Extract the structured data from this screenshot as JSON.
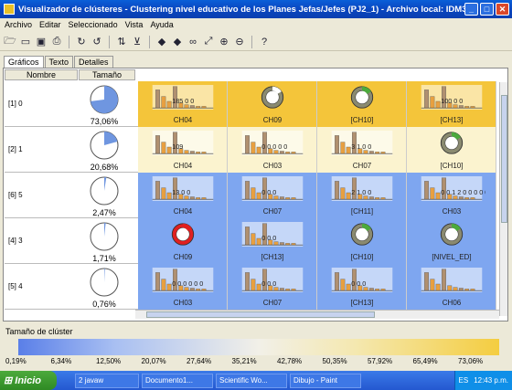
{
  "window": {
    "title": "Visualizador de clústeres - Clustering nivel educativo de los Planes Jefas/Jefes (PJ2_1) - Archivo local: IDM3933..."
  },
  "menu": [
    "Archivo",
    "Editar",
    "Seleccionado",
    "Vista",
    "Ayuda"
  ],
  "toolbar_icons": [
    "open-icon",
    "new-icon",
    "save-icon",
    "print-icon",
    "redo-icon",
    "undo-icon",
    "sort-icon",
    "filter-icon",
    "arrow-left-icon",
    "arrow-right-icon",
    "binoculars-icon",
    "resize-icon",
    "zoom-in-icon",
    "zoom-out-icon",
    "help-icon"
  ],
  "tabs": [
    "Gráficos",
    "Texto",
    "Detalles"
  ],
  "headers": {
    "name": "Nombre",
    "size": "Tamaño"
  },
  "colors": {
    "yellow": "#f4c53a",
    "cream": "#fbf3cf",
    "blue": "#7ea6f0"
  },
  "rows": [
    {
      "name": "[1] 0",
      "pct": "73,06%",
      "fraction": 0.7306,
      "bg": "yellow",
      "cells": [
        {
          "label": "CH04",
          "kind": "bar",
          "text": "185 0 0"
        },
        {
          "label": "CH09",
          "kind": "donut",
          "accent": "#ffffff"
        },
        {
          "label": "[CH10]",
          "kind": "donut",
          "accent": "#4caa3c"
        },
        {
          "label": "[CH13]",
          "kind": "bar",
          "text": "100 0 0"
        }
      ]
    },
    {
      "name": "[2] 1",
      "pct": "20,68%",
      "fraction": 0.2068,
      "bg": "cream",
      "cells": [
        {
          "label": "CH04",
          "kind": "bar",
          "text": "109"
        },
        {
          "label": "CH03",
          "kind": "bar",
          "text": "0 0 0 0 0"
        },
        {
          "label": "CH07",
          "kind": "bar",
          "text": "3 1 0 0"
        },
        {
          "label": "[CH10]",
          "kind": "donut",
          "accent": "#4caa3c"
        }
      ]
    },
    {
      "name": "[6] 5",
      "pct": "2,47%",
      "fraction": 0.0247,
      "bg": "blue",
      "cells": [
        {
          "label": "CH04",
          "kind": "bar",
          "text": "13 0 0"
        },
        {
          "label": "CH07",
          "kind": "bar",
          "text": "0 0 0"
        },
        {
          "label": "[CH11]",
          "kind": "bar",
          "text": "2 1 0 0"
        },
        {
          "label": "CH03",
          "kind": "bar",
          "text": "0 0 1 2 0 0 0 0 0"
        }
      ]
    },
    {
      "name": "[4] 3",
      "pct": "1,71%",
      "fraction": 0.0171,
      "bg": "blue",
      "cells": [
        {
          "label": "CH09",
          "kind": "donut",
          "accent": "#e02020"
        },
        {
          "label": "[CH13]",
          "kind": "bar",
          "text": "0 0 0"
        },
        {
          "label": "[CH10]",
          "kind": "donut",
          "accent": "#4caa3c"
        },
        {
          "label": "[NIVEL_ED]",
          "kind": "donut",
          "accent": "#4caa3c"
        }
      ]
    },
    {
      "name": "[5] 4",
      "pct": "0,76%",
      "fraction": 0.0076,
      "bg": "blue",
      "cells": [
        {
          "label": "CH03",
          "kind": "bar",
          "text": "0 0 0 0 0 0"
        },
        {
          "label": "CH07",
          "kind": "bar",
          "text": "0 0 0"
        },
        {
          "label": "[CH13]",
          "kind": "bar",
          "text": "0 0 0"
        },
        {
          "label": "CH06",
          "kind": "bar",
          "text": ""
        }
      ]
    }
  ],
  "legend": {
    "title": "Tamaño de clúster",
    "ticks": [
      "0,19%",
      "6,34%",
      "12,50%",
      "20,07%",
      "27,64%",
      "35,21%",
      "42,78%",
      "50,35%",
      "57,92%",
      "65,49%",
      "73,06%"
    ]
  },
  "taskbar": {
    "start": "Inicio",
    "items": [
      "2 javaw",
      "Documento1...",
      "Scientific Wo...",
      "Dibujo - Paint"
    ],
    "lang": "ES",
    "time": "12:43 p.m."
  }
}
